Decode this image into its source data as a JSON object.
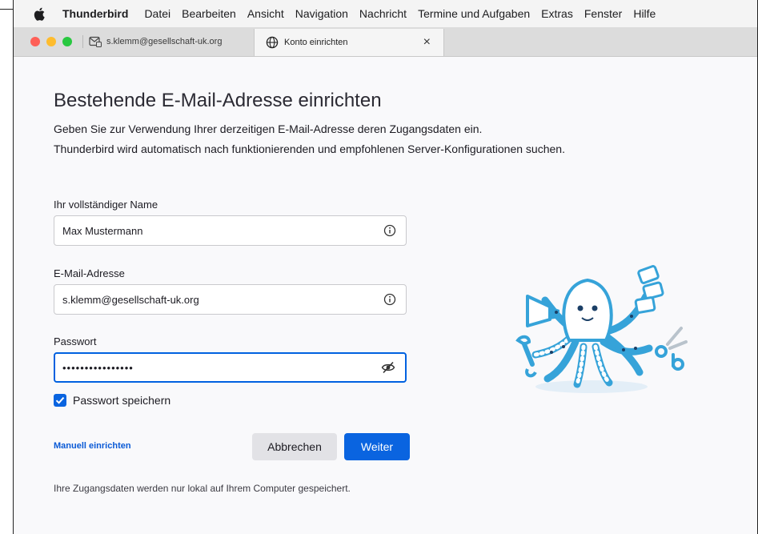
{
  "menubar": {
    "app": "Thunderbird",
    "items": [
      "Datei",
      "Bearbeiten",
      "Ansicht",
      "Navigation",
      "Nachricht",
      "Termine und Aufgaben",
      "Extras",
      "Fenster",
      "Hilfe"
    ]
  },
  "tabs": [
    {
      "label": "s.klemm@gesellschaft-uk.org",
      "icon": "mail-icon",
      "active": false
    },
    {
      "label": "Konto einrichten",
      "icon": "globe-icon",
      "active": true,
      "close": "×"
    }
  ],
  "content": {
    "title": "Bestehende E-Mail-Adresse einrichten",
    "intro_line1": "Geben Sie zur Verwendung Ihrer derzeitigen E-Mail-Adresse deren Zugangsdaten ein.",
    "intro_line2": "Thunderbird wird automatisch nach funktionierenden und empfohlenen Server-Konfigurationen suchen.",
    "name_field": {
      "label": "Ihr vollständiger Name",
      "value": "Max Mustermann",
      "icon": "info-icon"
    },
    "email_field": {
      "label": "E-Mail-Adresse",
      "value": "s.klemm@gesellschaft-uk.org",
      "icon": "info-icon"
    },
    "password_field": {
      "label": "Passwort",
      "value": "••••••••••••••••",
      "icon": "eye-slash-icon"
    },
    "remember_password": {
      "label": "Passwort speichern",
      "checked": true
    },
    "manual_link": "Manuell einrichten",
    "cancel_button": "Abbrechen",
    "next_button": "Weiter",
    "footer_note": "Ihre Zugangsdaten werden nur lokal auf Ihrem Computer gespeichert."
  },
  "colors": {
    "accent": "#0a64e0",
    "link": "#0a5ad6",
    "mascot": "#36a3d9"
  }
}
